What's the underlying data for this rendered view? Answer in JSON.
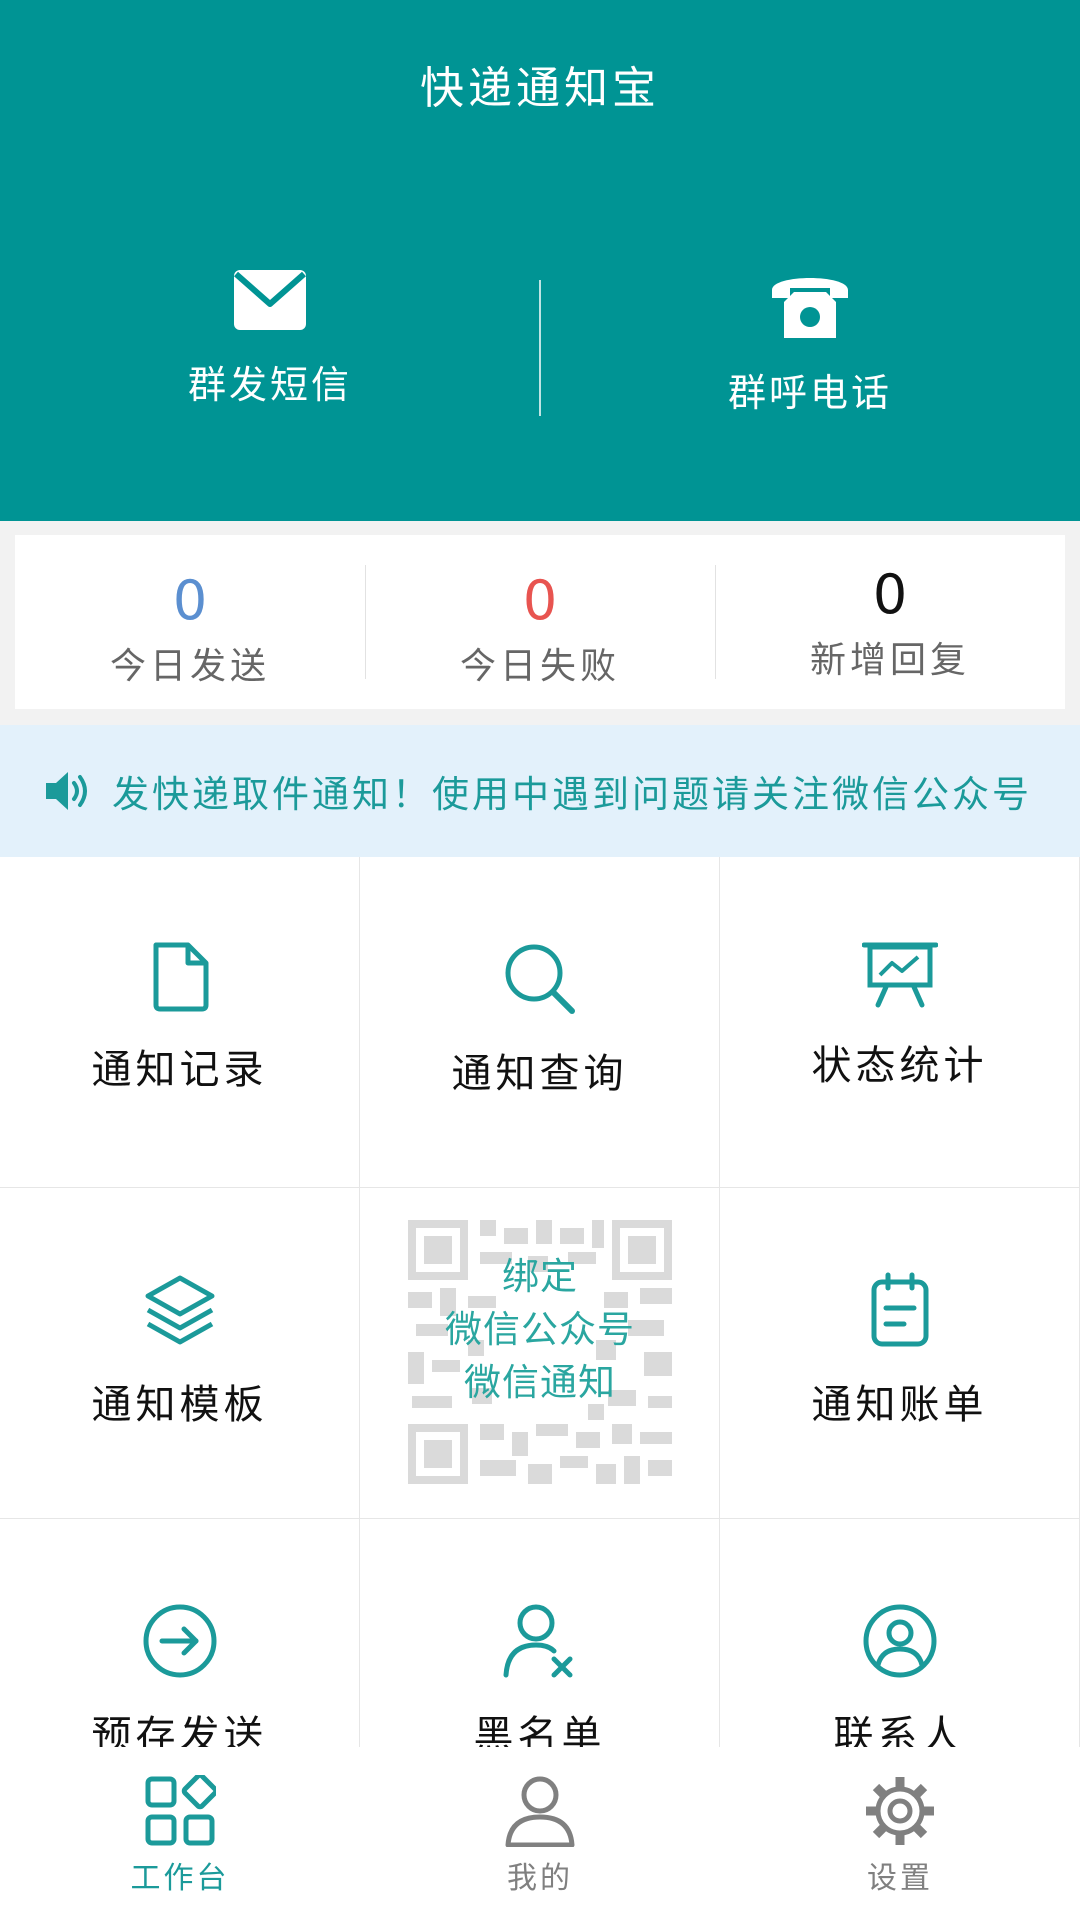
{
  "header": {
    "title": "快递通知宝",
    "actions": [
      {
        "label": "群发短信",
        "icon": "mail-icon"
      },
      {
        "label": "群呼电话",
        "icon": "phone-icon"
      }
    ]
  },
  "stats": [
    {
      "value": "0",
      "label": "今日发送",
      "color": "#5b8fd0"
    },
    {
      "value": "0",
      "label": "今日失败",
      "color": "#e85450"
    },
    {
      "value": "0",
      "label": "新增回复",
      "color": "#111111"
    }
  ],
  "notice": {
    "text": "发快递取件通知！使用中遇到问题请关注微信公众号",
    "icon": "speaker-icon"
  },
  "grid": {
    "items": [
      {
        "label": "通知记录",
        "icon": "document-icon"
      },
      {
        "label": "通知查询",
        "icon": "search-icon"
      },
      {
        "label": "状态统计",
        "icon": "presentation-chart-icon"
      },
      {
        "label": "通知模板",
        "icon": "layers-icon"
      },
      {
        "label": "通知账单",
        "icon": "notepad-icon"
      },
      {
        "label": "预存发送",
        "icon": "arrow-circle-icon"
      },
      {
        "label": "黑名单",
        "icon": "user-remove-icon"
      },
      {
        "label": "联系人",
        "icon": "user-circle-icon"
      }
    ],
    "qr_card": {
      "line1": "绑定",
      "line2": "微信公众号",
      "line3": "微信通知"
    }
  },
  "bottom_nav": [
    {
      "label": "工作台",
      "icon": "dashboard-icon",
      "active": true
    },
    {
      "label": "我的",
      "icon": "user-icon",
      "active": false
    },
    {
      "label": "设置",
      "icon": "gear-icon",
      "active": false
    }
  ],
  "colors": {
    "brand": "#009494",
    "accent": "#1b9a9a",
    "nav_active": "#1b9a9a",
    "nav_inactive": "#808080"
  }
}
